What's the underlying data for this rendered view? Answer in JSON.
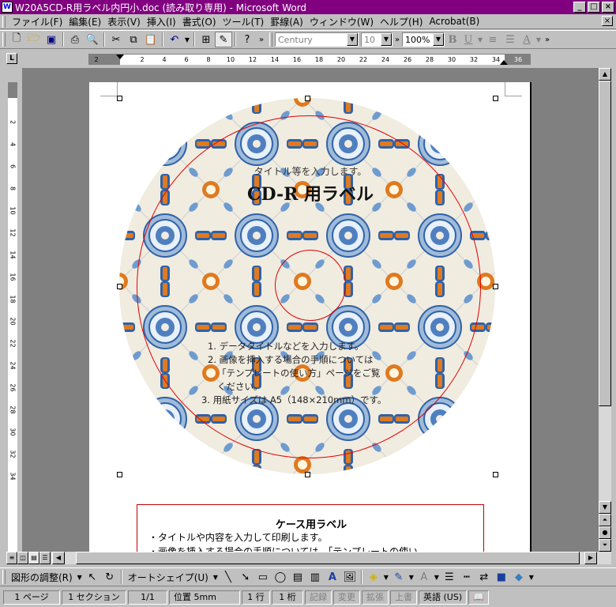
{
  "window": {
    "title": "W20A5CD-R用ラベル内円小.doc (読み取り専用) - Microsoft Word",
    "app_icon": "W"
  },
  "menu": [
    "ファイル(F)",
    "編集(E)",
    "表示(V)",
    "挿入(I)",
    "書式(O)",
    "ツール(T)",
    "罫線(A)",
    "ウィンドウ(W)",
    "ヘルプ(H)",
    "Acrobat(B)"
  ],
  "toolbar": {
    "font_name": "Century",
    "font_size": "10",
    "zoom": "100%",
    "bold": "B",
    "underline": "U",
    "font_color": "A"
  },
  "ruler": {
    "labels": [
      "2",
      "2",
      "4",
      "6",
      "8",
      "10",
      "12",
      "14",
      "16",
      "18",
      "20",
      "22",
      "24",
      "26",
      "28",
      "30",
      "32",
      "34",
      "36"
    ],
    "vlabels": [
      "2",
      "4",
      "6",
      "8",
      "10",
      "12",
      "14",
      "16",
      "18",
      "20",
      "22",
      "24",
      "26",
      "28",
      "30",
      "32",
      "34"
    ]
  },
  "document": {
    "disc_subtitle": "タイトル等を入力します。",
    "disc_title": "CD-R 用ラベル",
    "disc_lines": [
      "1. データタイトルなどを入力します。",
      "2. 画像を挿入する場合の手順については",
      "「テンプレートの使い方」ページをご覧",
      "ください。",
      "3. 用紙サイズは A5（148×210mm）です。"
    ],
    "case_title": "ケース用ラベル",
    "case_lines": [
      "・タイトルや内容を入力して印刷します。",
      "・画像を挿入する場合の手順については、「テンプレートの使い"
    ]
  },
  "draw_toolbar": {
    "adjust": "図形の調整(R)",
    "autoshape": "オートシェイプ(U)"
  },
  "status": {
    "page": "1 ページ",
    "section": "1 セクション",
    "pages": "1/1",
    "position": "位置 5mm",
    "line": "1 行",
    "column": "1 桁",
    "rec": "記録",
    "trk": "変更",
    "ext": "拡張",
    "ovr": "上書",
    "language": "英語 (US)"
  },
  "colors": {
    "titlebar": "#800080",
    "guide_red": "#e00000",
    "pattern_blue": "#2f62a8",
    "pattern_orange": "#e07a1f"
  }
}
